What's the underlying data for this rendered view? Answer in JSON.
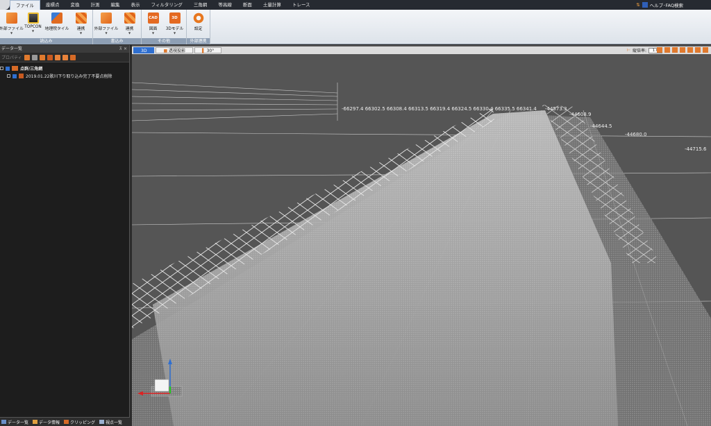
{
  "menubar": {
    "tabs": [
      "ファイル",
      "座標点",
      "変換",
      "計測",
      "編集",
      "表示",
      "フィルタリング",
      "三角網",
      "等高線",
      "断面",
      "土量計算",
      "トレース"
    ],
    "help_label": "ヘルプ･FAQ検索"
  },
  "ribbon": {
    "groups": [
      {
        "label": "読込み",
        "buttons": [
          "外部ファイル",
          "TOPCON",
          "地理院タイル",
          "連携"
        ]
      },
      {
        "label": "書込み",
        "buttons": [
          "外部ファイル",
          "連携"
        ]
      },
      {
        "label": "その他",
        "buttons": [
          "図面",
          "3Dモデル"
        ]
      },
      {
        "label": "外部連携",
        "buttons": [
          "設定"
        ]
      }
    ],
    "icon_text": {
      "cad": "CAD",
      "model3d": "3D"
    }
  },
  "left_panel": {
    "title": "データ一覧",
    "toolbar_label": "プロパティ",
    "tree": {
      "root_label": "点群/三角網",
      "child_label": "2019.01.22歌川下り取り込み完了不要点削除"
    },
    "bottom_tabs": [
      "データ一覧",
      "データ情報",
      "クリッピング",
      "視点一覧"
    ]
  },
  "viewport": {
    "tabs": [
      "3D",
      "透視投影",
      "30°"
    ],
    "zoom_label": "縦倍率:",
    "zoom_value": "1.0",
    "coord_row": "-66297.4 66302.5 66308.4 66313.5 66319.4 66324.5 66330.4 66335.5 66341.4",
    "coord_labels": [
      "-44573.3",
      "-44608.9",
      "-44644.5",
      "-44680.0",
      "-44715.6"
    ]
  },
  "colors": {
    "accent": "#e0651a",
    "active_tab": "#2f6fd0",
    "viewport_bg": "#555555",
    "panel_bg": "#1d1d1d"
  }
}
